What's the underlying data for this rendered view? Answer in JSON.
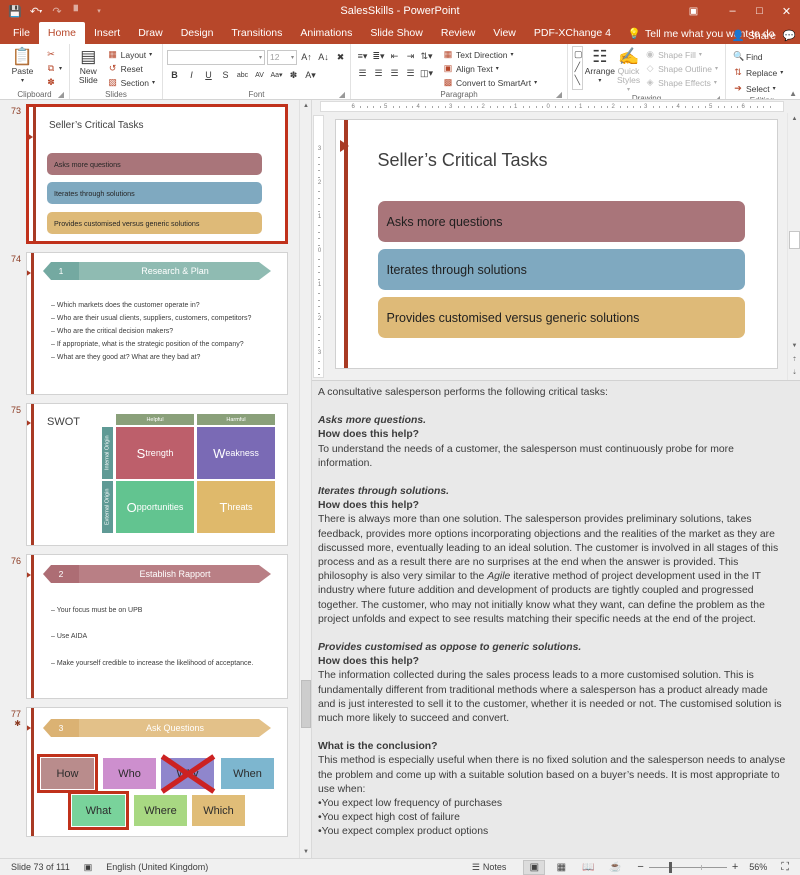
{
  "titlebar": {
    "document_title": "SalesSkills  -  PowerPoint",
    "qat": [
      {
        "name": "save-icon",
        "glyph": "ὋE"
      },
      {
        "name": "undo-icon",
        "glyph": "↶"
      },
      {
        "name": "redo-icon",
        "glyph": "↷"
      },
      {
        "name": "start-presentation-icon",
        "glyph": "⬚"
      },
      {
        "name": "customize-qat-icon",
        "glyph": "▾"
      }
    ],
    "window_controls": [
      {
        "name": "ribbon-display-options",
        "glyph": "⬛"
      },
      {
        "name": "minimize-button",
        "glyph": "−"
      },
      {
        "name": "restore-button",
        "glyph": "□"
      },
      {
        "name": "close-button",
        "glyph": "✕"
      }
    ]
  },
  "tabs": [
    {
      "label": "File",
      "active": false
    },
    {
      "label": "Home",
      "active": true
    },
    {
      "label": "Insert",
      "active": false
    },
    {
      "label": "Draw",
      "active": false
    },
    {
      "label": "Design",
      "active": false
    },
    {
      "label": "Transitions",
      "active": false
    },
    {
      "label": "Animations",
      "active": false
    },
    {
      "label": "Slide Show",
      "active": false
    },
    {
      "label": "Review",
      "active": false
    },
    {
      "label": "View",
      "active": false
    },
    {
      "label": "PDF-XChange 4",
      "active": false
    }
  ],
  "tellme": {
    "label": "Tell me what you want to do",
    "icon": "lightbulb-icon"
  },
  "share": {
    "label": "Share",
    "icon": "person-add-icon"
  },
  "comments": {
    "icon": "comments-icon"
  },
  "ribbon": {
    "groups": [
      {
        "name": "Clipboard",
        "big": [
          {
            "label": "Paste",
            "icon": "paste-icon",
            "glyph": "📋"
          }
        ],
        "small": [
          {
            "label": "",
            "icon": "cut-icon",
            "glyph": "✂"
          },
          {
            "label": "",
            "icon": "copy-icon",
            "glyph": "⧉"
          },
          {
            "label": "",
            "icon": "format-painter-icon",
            "glyph": "🖌"
          }
        ]
      },
      {
        "name": "Slides",
        "big": [
          {
            "label": "New Slide",
            "icon": "new-slide-icon",
            "glyph": "▤"
          }
        ],
        "small": [
          {
            "label": "Layout",
            "icon": "layout-icon",
            "glyph": "▦"
          },
          {
            "label": "Reset",
            "icon": "reset-icon",
            "glyph": "↺"
          },
          {
            "label": "Section",
            "icon": "section-icon",
            "glyph": "▧"
          }
        ]
      },
      {
        "name": "Font",
        "font_name": "",
        "font_size": "12",
        "buttons": [
          "B",
          "I",
          "U",
          "S",
          "abc",
          "AV",
          "Aa",
          "A"
        ]
      },
      {
        "name": "Paragraph",
        "small": [
          {
            "label": "Text Direction",
            "icon": "text-direction-icon"
          },
          {
            "label": "Align Text",
            "icon": "align-text-icon"
          },
          {
            "label": "Convert to SmartArt",
            "icon": "smartart-icon"
          }
        ]
      },
      {
        "name": "Drawing",
        "big": [
          {
            "label": "Arrange",
            "icon": "arrange-icon",
            "glyph": "◰"
          },
          {
            "label": "Quick Styles",
            "icon": "quick-styles-icon",
            "glyph": "✒"
          }
        ],
        "small": [
          {
            "label": "Shape Fill",
            "icon": "shape-fill-icon",
            "disabled": true
          },
          {
            "label": "Shape Outline",
            "icon": "shape-outline-icon",
            "disabled": true
          },
          {
            "label": "Shape Effects",
            "icon": "shape-effects-icon",
            "disabled": true
          }
        ]
      },
      {
        "name": "Editing",
        "small": [
          {
            "label": "Find",
            "icon": "find-icon",
            "glyph": "🔍"
          },
          {
            "label": "Replace",
            "icon": "replace-icon",
            "glyph": "ab"
          },
          {
            "label": "Select",
            "icon": "select-icon",
            "glyph": "↖"
          }
        ]
      }
    ]
  },
  "thumbnails": [
    {
      "number": "73",
      "selected": true,
      "kind": "tasks",
      "title": "Seller’s Critical Tasks",
      "bars": [
        {
          "text": "Asks more questions",
          "color": "#a9757a"
        },
        {
          "text": "Iterates through solutions",
          "color": "#7fa9c0"
        },
        {
          "text": "Provides customised versus generic solutions",
          "color": "#deba78"
        }
      ]
    },
    {
      "number": "74",
      "selected": false,
      "kind": "chevron-bullets",
      "step": "1",
      "heading": "Research & Plan",
      "chev_num_color": "#74a9a1",
      "chev_body_color": "#8fbbb2",
      "bullets": [
        "– Which markets does the customer operate in?",
        "– Who are their usual clients, suppliers, customers, competitors?",
        "– Who are the critical decision makers?",
        "– If appropriate, what is the strategic position of the company?",
        "– What are they good at? What are they bad at?"
      ]
    },
    {
      "number": "75",
      "selected": false,
      "kind": "swot",
      "title": "SWOT",
      "col_headers": [
        "Helpful",
        "Harmful"
      ],
      "row_headers": [
        "Internal Origin",
        "External Origin"
      ],
      "cells": [
        {
          "cap": "S",
          "rest": "trength",
          "color": "#bd5f6b"
        },
        {
          "cap": "W",
          "rest": "eakness",
          "color": "#7a6ab5"
        },
        {
          "cap": "O",
          "rest": "pportunities",
          "color": "#62c490"
        },
        {
          "cap": "T",
          "rest": "hreats",
          "color": "#dfb96b"
        }
      ]
    },
    {
      "number": "76",
      "selected": false,
      "kind": "chevron-bullets",
      "step": "2",
      "heading": "Establish Rapport",
      "chev_num_color": "#ad6d74",
      "chev_body_color": "#b97f85",
      "bullets": [
        "– Your focus must be on UPB",
        "– Use AIDA",
        "– Make yourself credible to increase the likelihood of acceptance."
      ]
    },
    {
      "number": "77",
      "star": "✱",
      "selected": false,
      "kind": "questions",
      "step": "3",
      "heading": "Ask Questions",
      "chev_num_color": "#dbb273",
      "chev_body_color": "#e3c189",
      "words": [
        {
          "text": "How",
          "color": "#b98c8c",
          "selected": true,
          "crossed": false
        },
        {
          "text": "Who",
          "color": "#cd8fce",
          "selected": false,
          "crossed": false
        },
        {
          "text": "Why",
          "color": "#8f86cc",
          "selected": false,
          "crossed": true
        },
        {
          "text": "When",
          "color": "#7db6cf",
          "selected": false,
          "crossed": false
        },
        {
          "text": "What",
          "color": "#79d39b",
          "selected": true,
          "crossed": false
        },
        {
          "text": "Where",
          "color": "#a8d882",
          "selected": false,
          "crossed": false
        },
        {
          "text": "Which",
          "color": "#e0bd78",
          "selected": false,
          "crossed": false
        }
      ]
    }
  ],
  "ruler": {
    "h_labels": [
      "6",
      "5",
      "4",
      "3",
      "2",
      "1",
      "0",
      "1",
      "2",
      "3",
      "4",
      "5",
      "6"
    ],
    "v_labels": [
      "3",
      "2",
      "1",
      "0",
      "1",
      "2",
      "3"
    ]
  },
  "slide": {
    "title": "Seller’s Critical Tasks",
    "bars": [
      {
        "text": "Asks more questions",
        "color": "#a9757a"
      },
      {
        "text": "Iterates through solutions",
        "color": "#7fa9c0"
      },
      {
        "text": "Provides customised versus generic solutions",
        "color": "#deba78"
      }
    ],
    "accent_color": "#a83a24"
  },
  "notes": {
    "paragraphs": [
      {
        "style": "plain",
        "gap": false,
        "text": "A consultative salesperson performs the following critical tasks:"
      },
      {
        "style": "bold-italic",
        "gap": true,
        "text": "Asks more questions."
      },
      {
        "style": "bold",
        "gap": false,
        "text": "How does this help?"
      },
      {
        "style": "plain",
        "gap": false,
        "text": "To understand the needs of a customer, the salesperson must continuously probe for more information."
      },
      {
        "style": "bold-italic",
        "gap": true,
        "text": "Iterates through solutions."
      },
      {
        "style": "bold",
        "gap": false,
        "text": "How does this help?"
      },
      {
        "style": "plain-agile",
        "gap": false,
        "text": "There is always more than one solution. The salesperson provides preliminary solutions, takes feedback, provides more options incorporating objections and the realities of the market as they are discussed more, eventually leading to an ideal solution. The customer is involved in all stages of this process and as a result there are no surprises at the end when the answer is provided. This philosophy is also very similar to the "
      },
      {
        "style": "italic-word",
        "text": "Agile"
      },
      {
        "style": "plain-cont",
        "text": " iterative method of project development used in the IT industry where future addition and development of products are tightly coupled and progressed together. The customer, who may not initially know what they want, can define the problem as the project unfolds and expect to see results matching their specific needs at the end of the project."
      },
      {
        "style": "bold-italic",
        "gap": true,
        "text": "Provides customised as oppose to generic solutions."
      },
      {
        "style": "bold",
        "gap": false,
        "text": "How does this help?"
      },
      {
        "style": "plain",
        "gap": false,
        "text": "The information collected during the sales process leads to a more customised solution. This is fundamentally different from traditional methods where a salesperson has a product already made and is just interested to sell it to the customer, whether it is needed or not. The customised solution is much more likely to succeed and convert."
      },
      {
        "style": "bold",
        "gap": true,
        "text": "What is the conclusion?"
      },
      {
        "style": "plain",
        "gap": false,
        "text": "This method is especially useful when there is no fixed solution and the salesperson needs to analyse the problem and come up with a suitable solution based on a buyer’s needs. It is most appropriate to use when:"
      },
      {
        "style": "plain",
        "gap": false,
        "text": "•You expect low frequency of purchases"
      },
      {
        "style": "plain",
        "gap": false,
        "text": "•You expect high cost of failure"
      },
      {
        "style": "plain",
        "gap": false,
        "text": "•You expect complex product options"
      }
    ]
  },
  "statusbar": {
    "slide_counter": "Slide 73 of 111",
    "accessibility_icon": "accessibility-icon",
    "language": "English (United Kingdom)",
    "notes_label": "Notes",
    "notes_icon": "notes-icon",
    "views": [
      {
        "name": "normal-view",
        "glyph": "▥",
        "active": true
      },
      {
        "name": "slide-sorter-view",
        "glyph": "☷",
        "active": false
      },
      {
        "name": "reading-view",
        "glyph": "▤",
        "active": false
      },
      {
        "name": "slide-show-view",
        "glyph": "△",
        "active": false
      }
    ],
    "zoom_out": "−",
    "zoom_in": "+",
    "zoom_level": "56%",
    "fit_icon": "fit-to-window-icon"
  }
}
